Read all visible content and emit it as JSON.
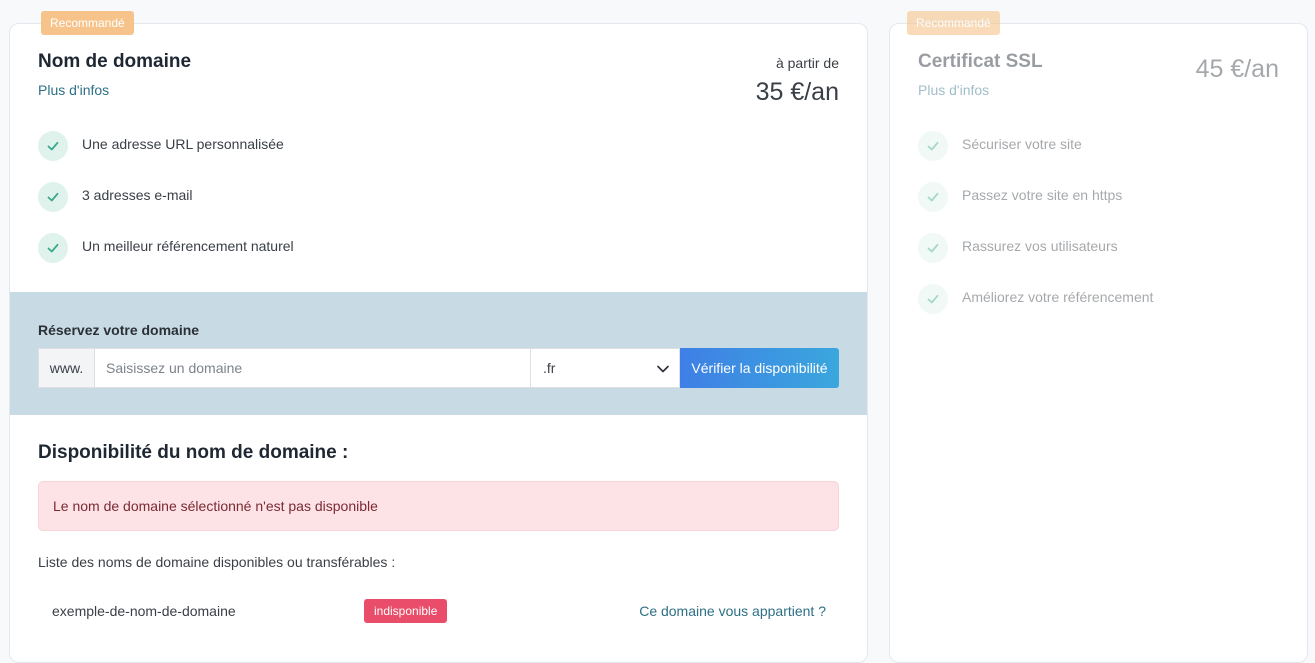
{
  "domain_card": {
    "badge": "Recommandé",
    "title": "Nom de domaine",
    "more_info": "Plus d'infos",
    "from_label": "à partir de",
    "price": "35 €/an",
    "features": [
      "Une adresse URL personnalisée",
      "3 adresses e-mail",
      "Un meilleur référencement naturel"
    ],
    "search": {
      "label": "Réservez votre domaine",
      "prefix": "www.",
      "placeholder": "Saisissez un domaine",
      "tld": ".fr",
      "button_label": "Vérifier la disponibilité"
    },
    "availability": {
      "title": "Disponibilité du nom de domaine :",
      "alert": "Le nom de domaine sélectionné n'est pas disponible",
      "list_label": "Liste des noms de domaine disponibles ou transférables :",
      "results": [
        {
          "domain": "exemple-de-nom-de-domaine",
          "status": "indisponible",
          "action": "Ce domaine vous appartient ?"
        }
      ]
    }
  },
  "ssl_card": {
    "badge": "Recommandé",
    "title": "Certificat SSL",
    "more_info": "Plus d'infos",
    "price": "45 €/an",
    "features": [
      "Sécuriser votre site",
      "Passez votre site en https",
      "Rassurez vos utilisateurs",
      "Améliorez votre référencement"
    ]
  },
  "colors": {
    "accent_link": "#2d7085",
    "badge": "#f6c48b",
    "band": "#c8dbe5",
    "check_bg": "#dff3ec",
    "check": "#3aa88a",
    "unavailable": "#ea4d69",
    "alert_bg": "#fde3e6"
  }
}
